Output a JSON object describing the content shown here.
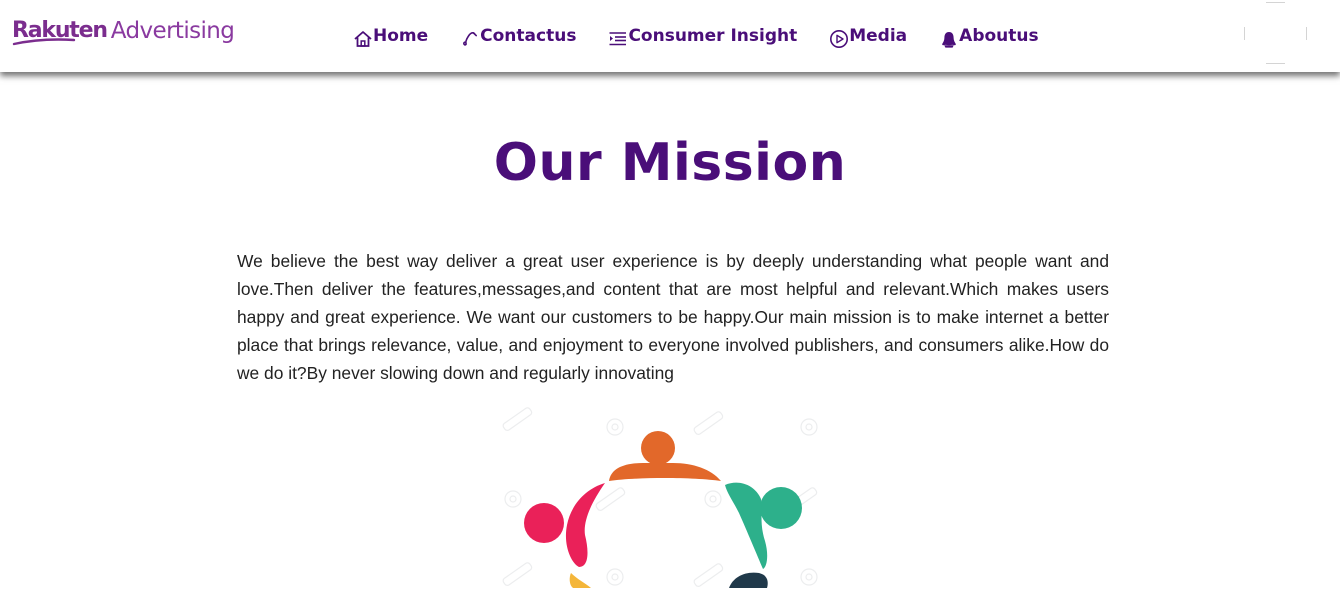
{
  "brand": {
    "name_part1": "Rakuten",
    "name_part2": "Advertising",
    "color": "#7b2d8e"
  },
  "nav": {
    "color": "#4a0e79",
    "items": [
      {
        "label": "Home",
        "icon": "home-icon"
      },
      {
        "label": "Contactus",
        "icon": "phone-icon"
      },
      {
        "label": "Consumer Insight",
        "icon": "list-icon"
      },
      {
        "label": "Media",
        "icon": "play-icon"
      },
      {
        "label": "Aboutus",
        "icon": "user-icon"
      }
    ]
  },
  "mission": {
    "title": "Our Mission",
    "body": "We believe the best way deliver a great user experience is by deeply understanding what people want and love.Then deliver the features,messages,and content that are most helpful and relevant.Which makes users happy and great experience. We want our customers to be happy.Our main mission is to make internet a better place that brings relevance, value, and enjoyment to everyone involved publishers, and consumers alike.How do we do it?By never slowing down and regularly innovating"
  },
  "image": {
    "subject": "team-circle-illustration",
    "colors": [
      "#e2682a",
      "#2db08b",
      "#ea2159",
      "#f4b63a",
      "#20394a"
    ]
  }
}
